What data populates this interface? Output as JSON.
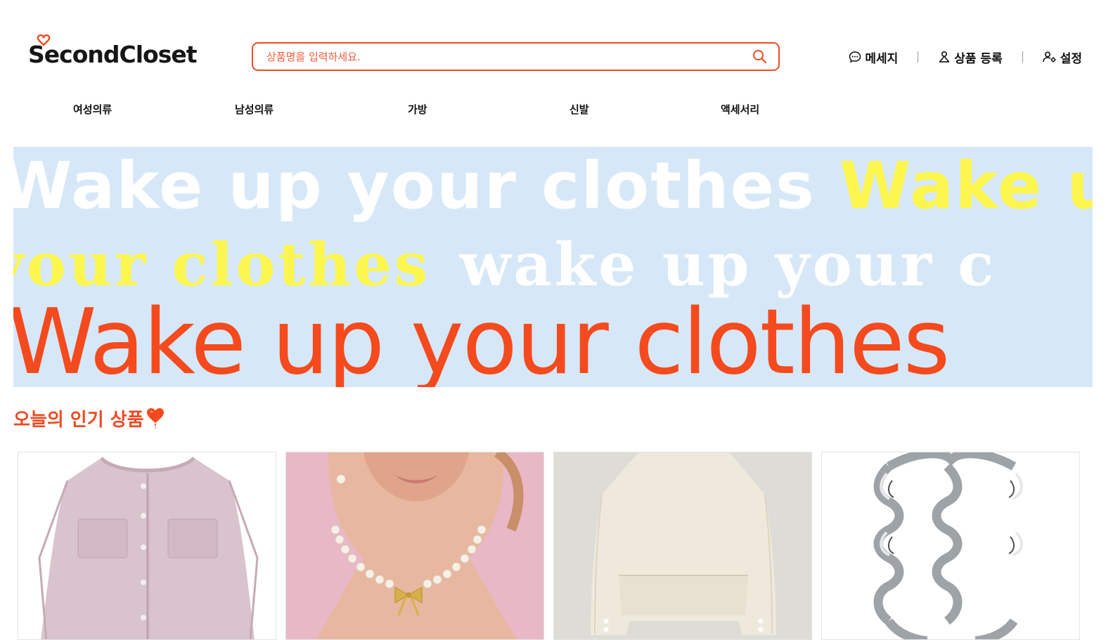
{
  "header": {
    "logo_text": "SecondCloset",
    "search": {
      "placeholder": "상품명을 입력하세요.",
      "value": ""
    },
    "menu": [
      {
        "label": "메세지",
        "icon": "chat-bubble-icon"
      },
      {
        "label": "상품 등록",
        "icon": "user-upload-icon"
      },
      {
        "label": "설정",
        "icon": "user-settings-icon"
      }
    ]
  },
  "categories": [
    "여성의류",
    "남성의류",
    "가방",
    "신발",
    "액세서리"
  ],
  "banner": {
    "line1_white": "Wake up your clothes",
    "line1_yellow": "Wake up your",
    "line2_yellow": "your clothes",
    "line2_white": "wake up your c",
    "line3": "Wake up your clothes"
  },
  "section": {
    "title": "오늘의 인기 상품",
    "icon": "heart-balloon-icon"
  },
  "products": [
    {
      "image": "pink-tweed-jacket"
    },
    {
      "image": "pearl-bow-necklace"
    },
    {
      "image": "cream-cropped-jacket"
    },
    {
      "image": "silver-infinity-ring"
    }
  ],
  "colors": {
    "accent": "#ef4a23",
    "banner_bg": "#d6e8f8",
    "banner_yellow": "#fbf54d",
    "banner_orange": "#f44a1d"
  }
}
